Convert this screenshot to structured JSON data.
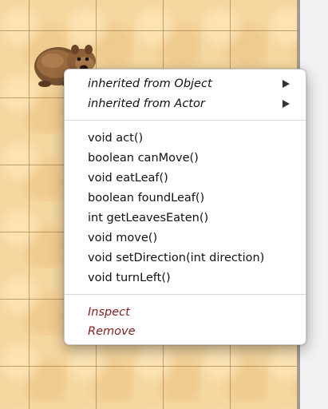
{
  "world": {
    "actor_icon": "wombat-icon",
    "background_color": "#f5d7a0"
  },
  "menu": {
    "inherited": [
      {
        "label": "inherited from Object"
      },
      {
        "label": "inherited from Actor"
      }
    ],
    "methods": [
      {
        "label": "void act()"
      },
      {
        "label": "boolean canMove()"
      },
      {
        "label": "void eatLeaf()"
      },
      {
        "label": "boolean foundLeaf()"
      },
      {
        "label": "int getLeavesEaten()"
      },
      {
        "label": "void move()"
      },
      {
        "label": "void setDirection(int direction)"
      },
      {
        "label": "void turnLeft()"
      }
    ],
    "actions": [
      {
        "label": "Inspect"
      },
      {
        "label": "Remove"
      }
    ],
    "submenu_icon": "triangle-right-icon",
    "action_color": "#8a1c1c"
  }
}
